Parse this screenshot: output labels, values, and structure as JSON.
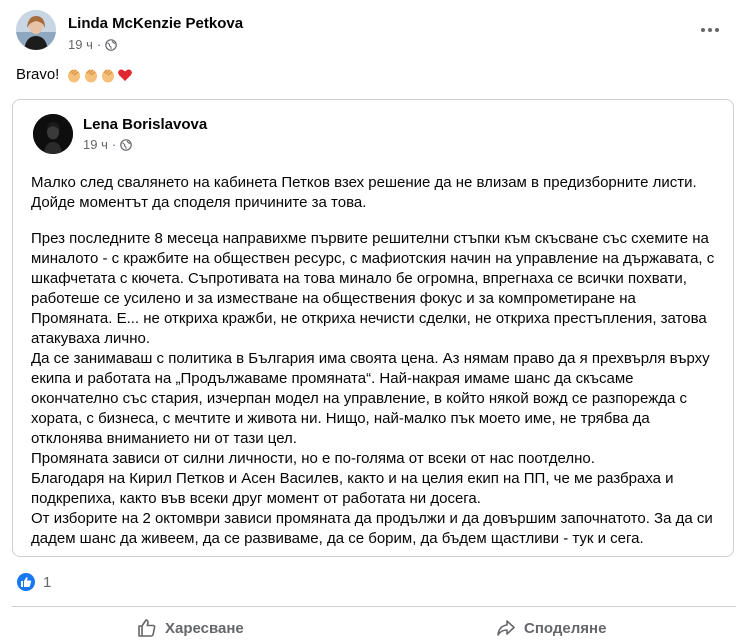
{
  "post": {
    "author": "Linda McKenzie Petkova",
    "time": "19 ч",
    "audience_icon": "globe-icon",
    "text": "Bravo!",
    "emojis": [
      "clap-emoji",
      "clap-emoji",
      "clap-emoji",
      "heart-emoji"
    ]
  },
  "shared": {
    "author": "Lena Borislavova",
    "time": "19 ч",
    "paragraphs": [
      "Малко след свалянето на кабинета Петков взех решение да не влизам в предизборните листи. Дойде моментът да споделя причините за това.",
      "През последните 8 месеца направихме първите решителни стъпки към скъсване със схемите на миналото - с кражбите на обществен ресурс, с мафиотския начин на управление на държавата, с шкафчетата с кючета. Съпротивата на това минало бе огромна, впрегнаха се всички похвати, работеше се усилено и за изместване на обществения фокус и за компрометиране на Промяната. Е... не откриха кражби, не откриха нечисти сделки, не откриха престъпления, затова атакуваха лично.",
      "Да се занимаваш с политика в България има своята цена. Аз нямам право да я прехвърля върху екипа и работата на „Продължаваме промяната“. Най-накрая имаме шанс да скъсаме окончателно със стария, изчерпан модел на управление, в който някой вожд се разпорежда с хората, с бизнеса, с мечтите и живота ни. Нищо, най-малко пък моето име, не трябва да отклонява вниманието ни от тази цел.",
      "Промяната зависи от силни личности, но е по-голяма от всеки от нас поотделно.",
      "Благодаря на Кирил Петков и Асен Василев, както и на целия екип на ПП, че ме разбраха и подкрепиха, както във всеки друг момент от работата ни досега.",
      "От изборите на 2 октомври зависи промяната да продължи и да довършим започнатото. За да си дадем шанс да живеем, да се развиваме, да се борим, да бъдем щастливи - тук и сега."
    ]
  },
  "reactions": {
    "count": "1"
  },
  "actions": {
    "like_label": "Харесване",
    "share_label": "Споделяне"
  },
  "colors": {
    "accent": "#1877f2",
    "muted": "#65676b",
    "border": "#ced0d4"
  }
}
